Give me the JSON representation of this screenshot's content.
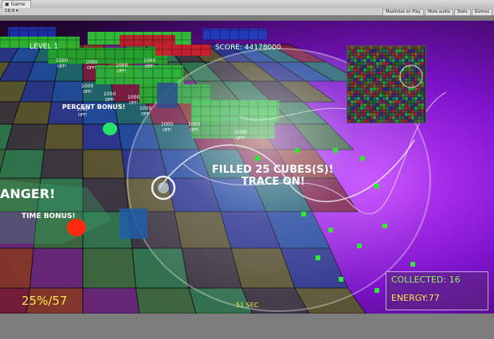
{
  "editor": {
    "tab_label": "Game",
    "aspect_label": "16:9",
    "buttons": [
      "Maximize on Play",
      "Mute audio",
      "Stats",
      "Gizmos"
    ]
  },
  "hud": {
    "level": "LEVEL 1",
    "score": "SCORE: 44178000",
    "percent_bonus": "PERCENT BONUS!",
    "time_bonus": "TIME BONUS!",
    "danger": "ANGER!",
    "filled_cubes": "FILLED 25 CUBES(S)!",
    "trace_on": "TRACE ON!",
    "progress": "25%/57",
    "timer": "51 SEC",
    "collected": "COLLECTED: 16",
    "energy": "ENERGY:77",
    "pickup_1000": "1000",
    "pickup_off": "OFF!"
  },
  "colors": {
    "hud_yellow": "#f5e94a",
    "hud_green": "#8cf25a",
    "hud_white": "#ffffff",
    "panel_border": "#d7b8f0"
  }
}
